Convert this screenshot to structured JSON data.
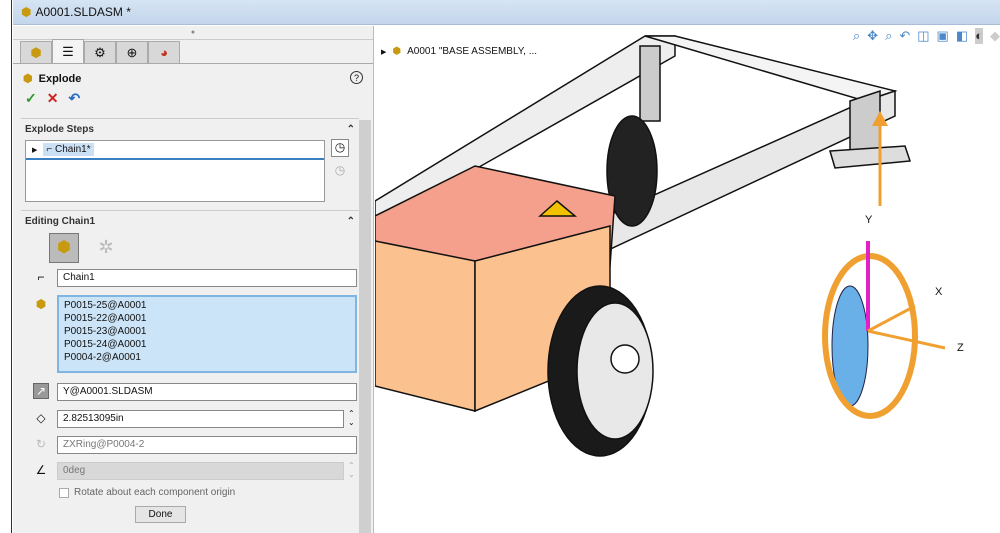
{
  "window": {
    "title": "A0001.SLDASM *"
  },
  "panel": {
    "tabs": [
      "feature-manager",
      "property-manager",
      "configuration-manager",
      "dimxpert-manager",
      "display-manager"
    ],
    "title": "Explode",
    "help": "?",
    "ok": "✓",
    "cancel": "✕",
    "undo": "↶",
    "explode_steps": {
      "header": "Explode Steps",
      "items": [
        {
          "label": "Chain1*"
        }
      ]
    },
    "editing": {
      "header": "Editing Chain1",
      "name": "Chain1",
      "components": [
        "P0015-25@A0001",
        "P0015-22@A0001",
        "P0015-23@A0001",
        "P0015-24@A0001",
        "P0004-2@A0001"
      ],
      "direction": "Y@A0001.SLDASM",
      "distance": "2.82513095in",
      "rotation_axis": "ZXRing@P0004-2",
      "angle": "0deg",
      "rotate_checkbox": "Rotate about each component origin",
      "rotate_checked": false,
      "done": "Done"
    }
  },
  "viewport": {
    "tree_label": "A0001 \"BASE ASSEMBLY, ...",
    "axes": {
      "x": "X",
      "y": "Y",
      "z": "Z"
    },
    "colors": {
      "triad_y": "#e020c8",
      "triad_xz": "#f0a030",
      "ring": "#f0a030",
      "box": "#f5a08c",
      "panel": "#fbc290"
    }
  }
}
